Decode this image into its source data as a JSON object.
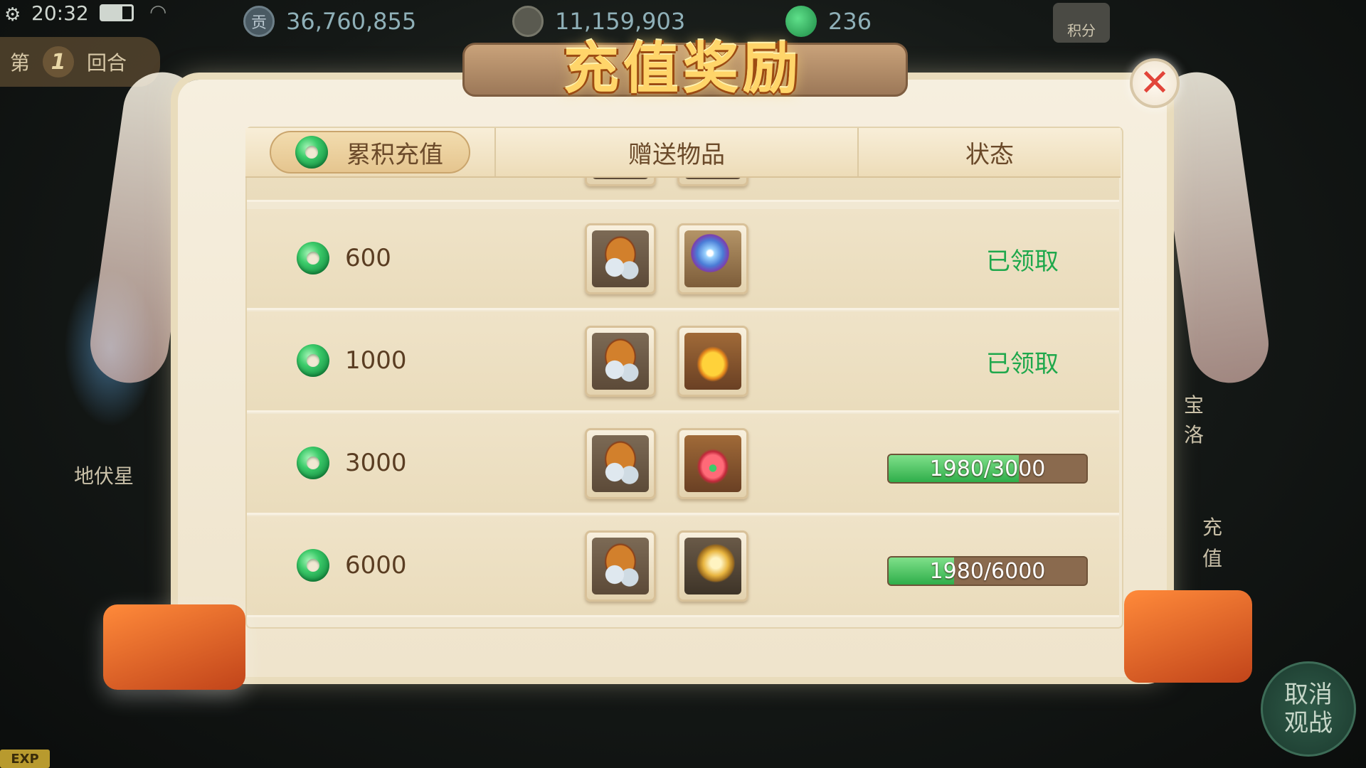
{
  "status_bar": {
    "time": "20:32"
  },
  "hud": {
    "round_prefix": "第",
    "round_number": "1",
    "round_suffix": "回合",
    "contribution_icon_text": "贡",
    "contribution_value": "36,760,855",
    "power_value": "11,159,903",
    "jade_value": "236",
    "score_label": "积分"
  },
  "side": {
    "left_character_label": "地伏星",
    "right_hint_1": "宝",
    "right_hint_2": "洛",
    "right_hint_3": "充值",
    "cancel_watch_line1": "取消",
    "cancel_watch_line2": "观战",
    "exp_label": "EXP"
  },
  "dialog": {
    "title": "充值奖励",
    "close_symbol": "✕",
    "headers": {
      "recharge": "累积充值",
      "gifts": "赠送物品",
      "status": "状态"
    },
    "rows": [
      {
        "amount": "600",
        "items": [
          "silver-bag-icon",
          "crystal-orb-icon"
        ],
        "state": "claimed",
        "status_text": "已领取"
      },
      {
        "amount": "1000",
        "items": [
          "silver-bag-icon",
          "gold-lucky-bag-icon"
        ],
        "state": "claimed",
        "status_text": "已领取"
      },
      {
        "amount": "3000",
        "items": [
          "silver-bag-icon",
          "red-lucky-bag-icon"
        ],
        "state": "progress",
        "current": 1980,
        "target": 3000,
        "progress_text": "1980/3000"
      },
      {
        "amount": "6000",
        "items": [
          "silver-bag-icon",
          "golden-dragon-icon"
        ],
        "state": "progress",
        "current": 1980,
        "target": 6000,
        "progress_text": "1980/6000"
      }
    ]
  },
  "colors": {
    "claimed_green": "#1fa84c",
    "progress_fill": "#2fae4a",
    "title_gold": "#ffd56a",
    "close_red": "#e2453a"
  }
}
